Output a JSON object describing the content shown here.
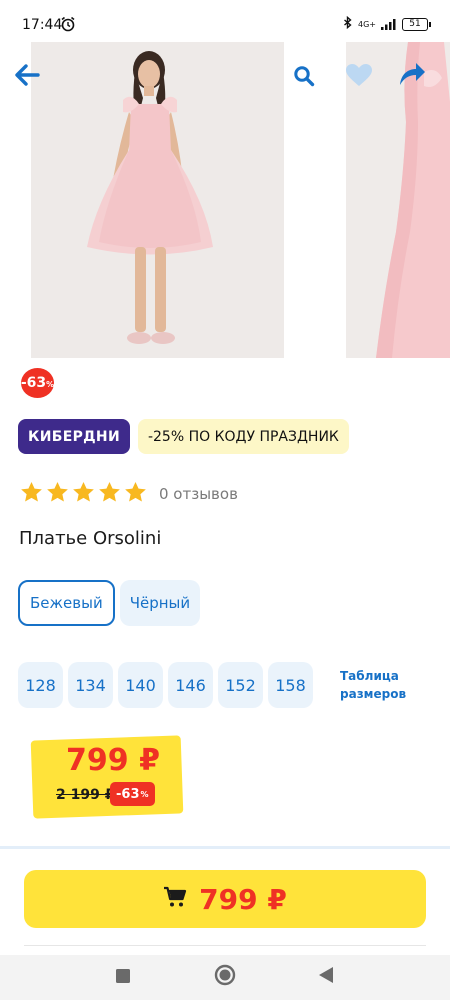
{
  "status_bar": {
    "time": "17:44",
    "network": "4G+",
    "battery": "51"
  },
  "toolbar": {
    "back_icon": "arrow-left-icon",
    "search_icon": "search-icon",
    "favorite_icon": "heart-icon",
    "share_icon": "share-icon"
  },
  "product": {
    "discount_badge": "-63",
    "discount_badge_pct": "%",
    "promo_brand": "КИБЕРДНИ",
    "promo_code": "-25% ПО КОДУ ПРАЗДНИК",
    "rating_stars": 5,
    "reviews": "0 отзывов",
    "title": "Платье Orsolini",
    "colors": [
      "Бежевый",
      "Чёрный"
    ],
    "selected_color": "Бежевый",
    "sizes": [
      "128",
      "134",
      "140",
      "146",
      "152",
      "158"
    ],
    "size_table_label": "Таблица размеров",
    "price": "799 ₽",
    "old_price": "2 199 ₽",
    "price_discount": "-63",
    "price_discount_pct": "%"
  },
  "buy_button": {
    "icon": "cart-icon",
    "price": "799 ₽"
  },
  "colors": {
    "accent_blue": "#1771c7",
    "sale_red": "#ef3124",
    "promo_purple": "#3e2a8b",
    "price_yellow": "#ffe33a",
    "star_yellow": "#f8b820"
  }
}
